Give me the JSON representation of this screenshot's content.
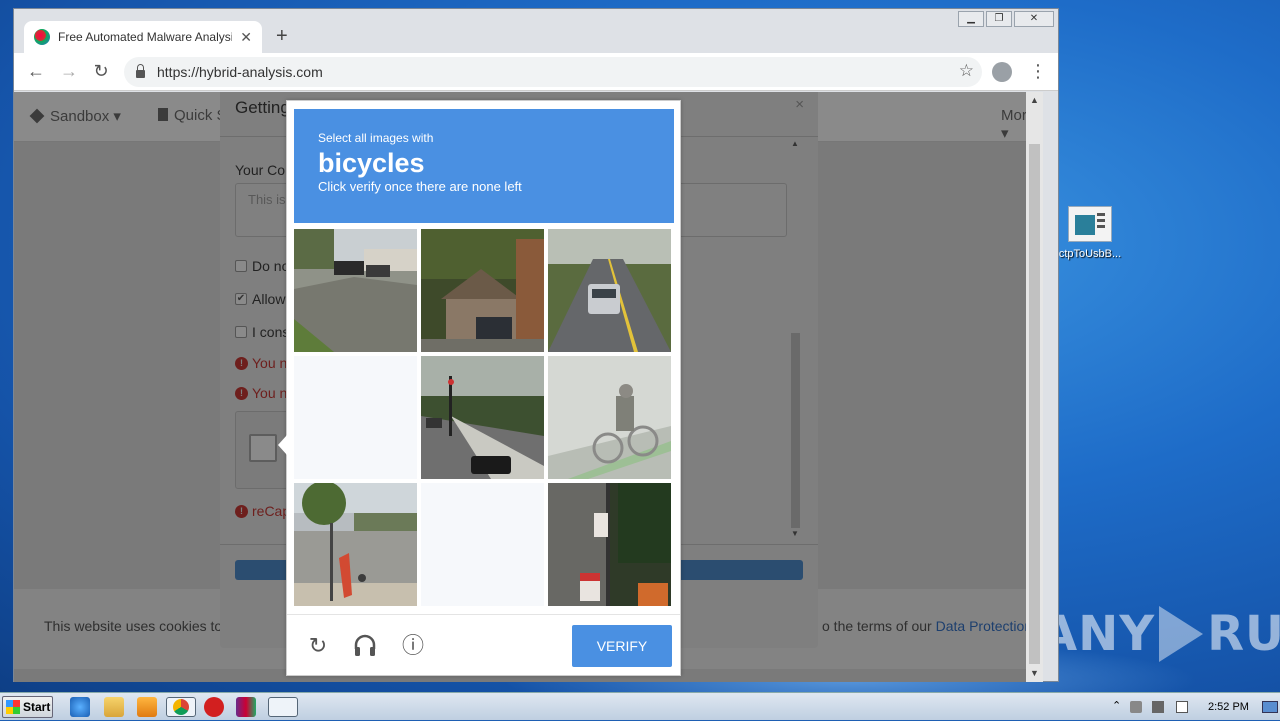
{
  "browser": {
    "tab_title": "Free Automated Malware Analysis Se",
    "url": "https://hybrid-analysis.com",
    "new_tab": "+",
    "tab_close": "✕",
    "back": "←",
    "forward": "→",
    "reload": "↻",
    "star": "☆",
    "menu": "⋮",
    "win_min": "▁",
    "win_max": "❐",
    "win_close": "✕"
  },
  "site": {
    "nav_sandbox": "Sandbox ▾",
    "nav_quick": "Quick S",
    "nav_more": "More ▾",
    "cookie_text": "This website uses cookies to",
    "cookie_text2": "o the terms of our",
    "cookie_link": "Data Protection"
  },
  "modal": {
    "title": "Getting Things Ready",
    "close": "×",
    "comment_label": "Your Cor",
    "comment_placeholder": "This is",
    "check1": "Do no",
    "check2": "Allow",
    "check3": "I cons",
    "err1": "You n",
    "err2": "You n",
    "err3": "reCap",
    "check_mark": "✔",
    "err_mark": "!"
  },
  "captcha": {
    "line1": "Select all images with",
    "target": "bicycles",
    "line3": "Click verify once there are none left",
    "reload_icon": "↻",
    "audio_icon": "🎧",
    "info_icon": "ⓘ",
    "verify": "VERIFY"
  },
  "desktop": {
    "icon_label": "ctpToUsbB...",
    "watermark_left": "ANY",
    "watermark_right": "RUN"
  },
  "taskbar": {
    "start": "Start",
    "clock": "2:52 PM"
  }
}
